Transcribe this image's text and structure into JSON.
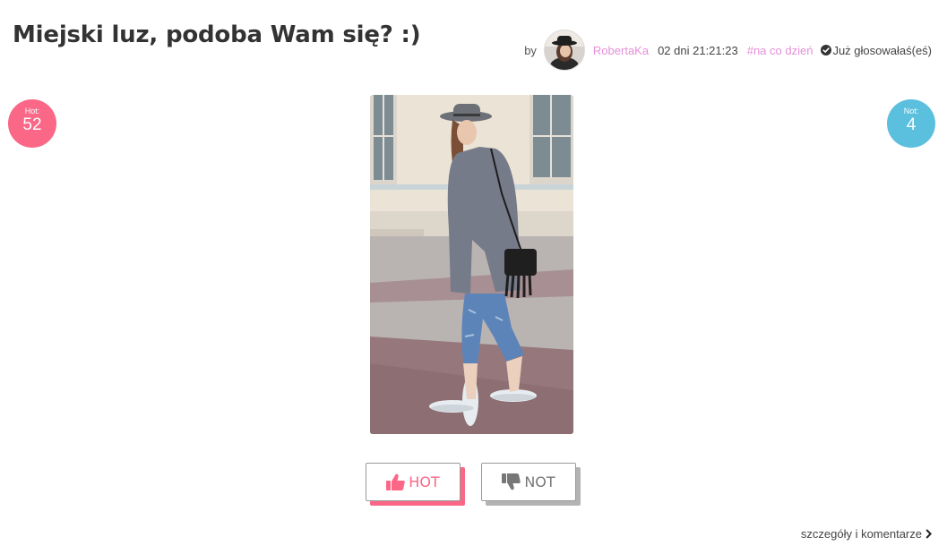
{
  "post": {
    "title": "Miejski luz, podoba Wam się? :)",
    "by_label": "by",
    "author": "RobertaKa",
    "time": "02 dni 21:21:23",
    "tag": "#na co dzień",
    "voted_text": "Już głosowałaś(eś)"
  },
  "scores": {
    "hot_label": "Hot:",
    "hot_count": "52",
    "not_label": "Not:",
    "not_count": "4"
  },
  "buttons": {
    "hot_label": "HOT",
    "not_label": "NOT"
  },
  "footer": {
    "details_label": "szczegóły i komentarze"
  },
  "colors": {
    "hot": "#fa6787",
    "not": "#5bc0de",
    "link": "#e58fd8"
  },
  "icons": {
    "voted": "check-circle-icon",
    "hot": "thumbs-up-icon",
    "not": "thumbs-down-icon",
    "details": "chevron-right-icon"
  }
}
